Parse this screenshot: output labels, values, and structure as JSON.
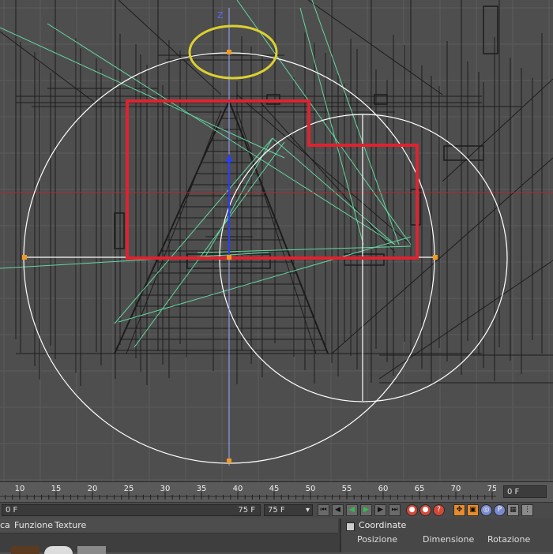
{
  "viewport": {
    "axis_label": "Z",
    "colors": {
      "background": "#4e4e4e",
      "grid": "#5c5c5c",
      "wire": "#1c1c1c",
      "selection": "#e0222f",
      "spline": "#63d6a0",
      "circle": "#ffffff",
      "highlight": "#dcd030",
      "axis_z": "#2a3cff",
      "point": "#f39a1c",
      "horizon": "#b02828"
    }
  },
  "timeline": {
    "ticks": [
      "10",
      "15",
      "20",
      "25",
      "30",
      "35",
      "40",
      "45",
      "50",
      "55",
      "60",
      "65",
      "70",
      "75"
    ],
    "current_frame": "0 F"
  },
  "controls": {
    "start_frame": "0 F",
    "end_frame": "75 F",
    "max_frame": "75 F",
    "buttons": [
      "go-start",
      "prev-key",
      "play-backward",
      "play-forward",
      "next-key",
      "go-end"
    ],
    "record_buttons": [
      "record",
      "auto-key",
      "keyframe-selection"
    ],
    "key_buttons": [
      "key-position",
      "key-scale",
      "key-rotation",
      "key-parameter",
      "key-point-level"
    ]
  },
  "materials": {
    "menu": [
      "ca",
      "Funzione",
      "Texture"
    ]
  },
  "coordinates": {
    "title": "Coordinate",
    "columns": [
      "Posizione",
      "Dimensione",
      "Rotazione"
    ]
  }
}
